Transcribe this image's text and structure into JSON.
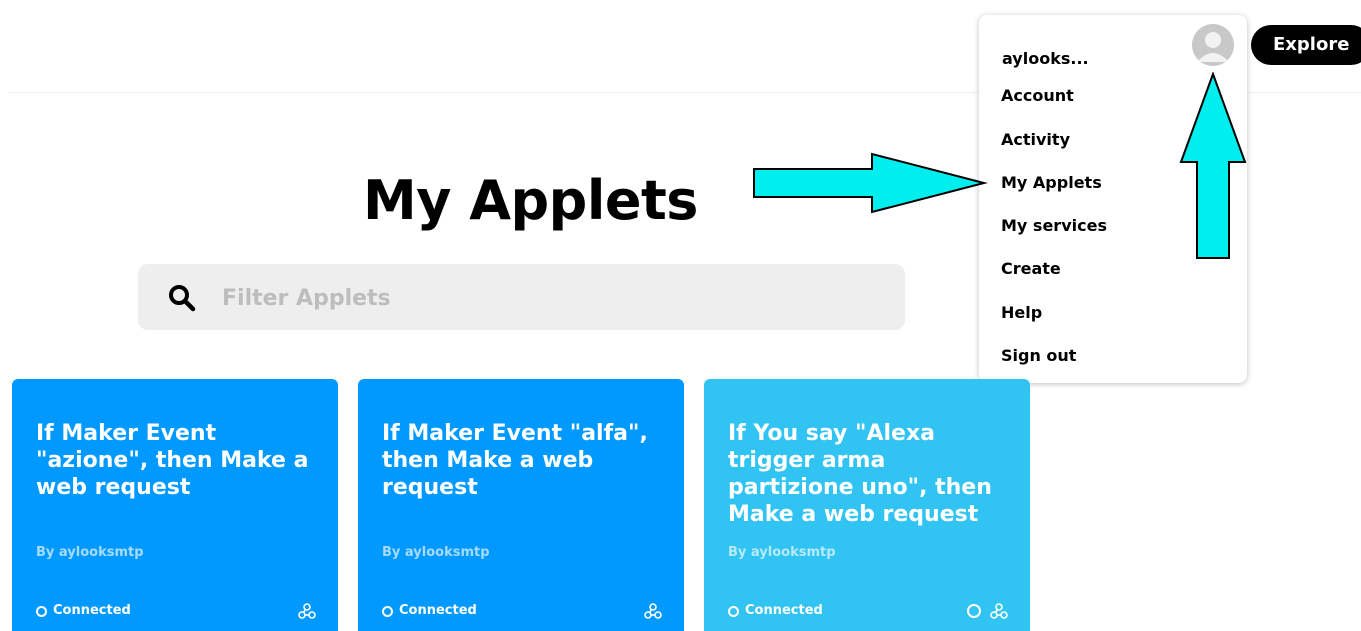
{
  "header": {
    "explore_label": "Explore"
  },
  "dropdown": {
    "username": "aylooks...",
    "items": [
      {
        "label": "Account"
      },
      {
        "label": "Activity"
      },
      {
        "label": "My Applets"
      },
      {
        "label": "My services"
      },
      {
        "label": "Create"
      },
      {
        "label": "Help"
      },
      {
        "label": "Sign out"
      }
    ]
  },
  "main": {
    "title": "My Applets",
    "filter": {
      "placeholder": "Filter Applets",
      "value": ""
    },
    "cards": [
      {
        "title": "If Maker Event \"azione\", then Make a web request",
        "author": "By aylooksmtp",
        "status": "Connected",
        "color": "#0099ff"
      },
      {
        "title": "If Maker Event \"alfa\", then Make a web request",
        "author": "By aylooksmtp",
        "status": "Connected",
        "color": "#0099ff"
      },
      {
        "title": "If You say \"Alexa trigger arma partizione uno\", then Make a web request",
        "author": "By aylooksmtp",
        "status": "Connected",
        "color": "#31c4f3"
      }
    ]
  },
  "annotation": {
    "arrow_color": "#00eeee"
  }
}
